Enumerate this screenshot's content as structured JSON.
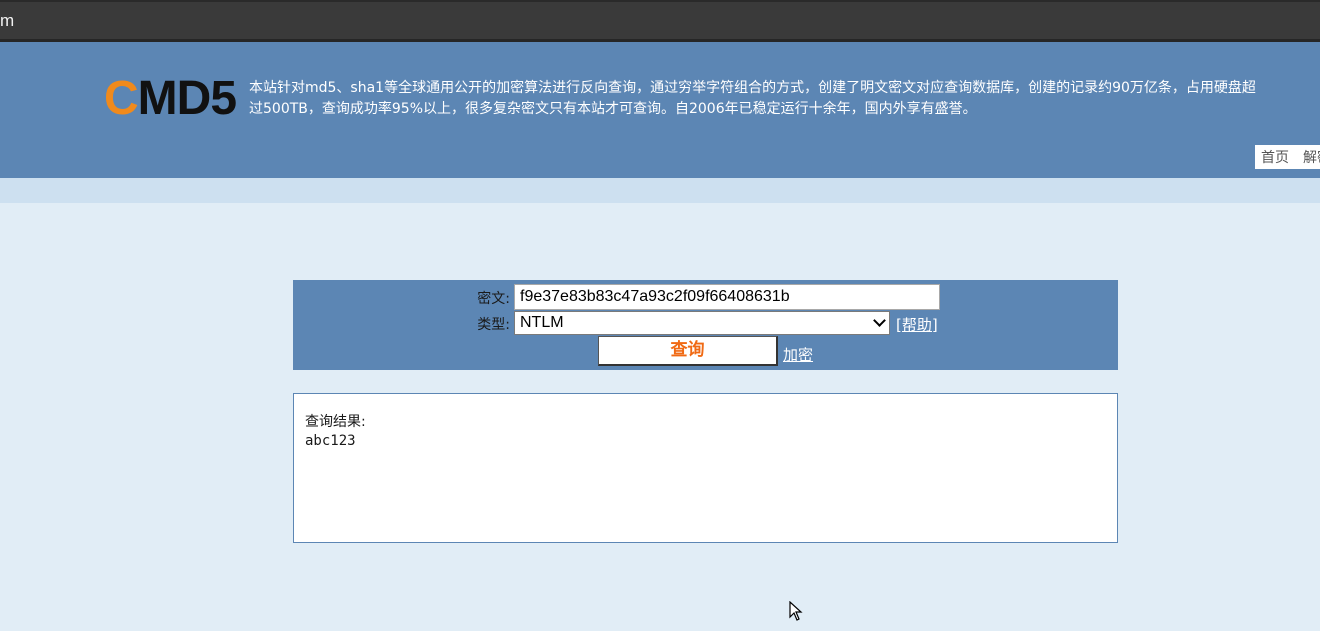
{
  "browser": {
    "url_fragment": "m"
  },
  "header": {
    "logo_c": "C",
    "logo_rest": "MD5",
    "tagline_line1": "本站针对md5、sha1等全球通用公开的加密算法进行反向查询，通过穷举字符组合的方式，创建了明文密文对应查询数据库，创建的记录约90万亿条，占用硬盘超",
    "tagline_line2": "过500TB，查询成功率95%以上，很多复杂密文只有本站才可查询。自2006年已稳定运行十余年，国内外享有盛誉。",
    "nav": {
      "home": "首页",
      "decrypt": "解密"
    }
  },
  "query": {
    "cipher_label": "密文:",
    "cipher_value": "f9e37e83b83c47a93c2f09f66408631b",
    "type_label": "类型:",
    "type_value": "NTLM",
    "help_link": "[帮助]",
    "query_button": "查询",
    "encrypt_link": "加密"
  },
  "result": {
    "label": "查询结果:",
    "value": "abc123"
  }
}
